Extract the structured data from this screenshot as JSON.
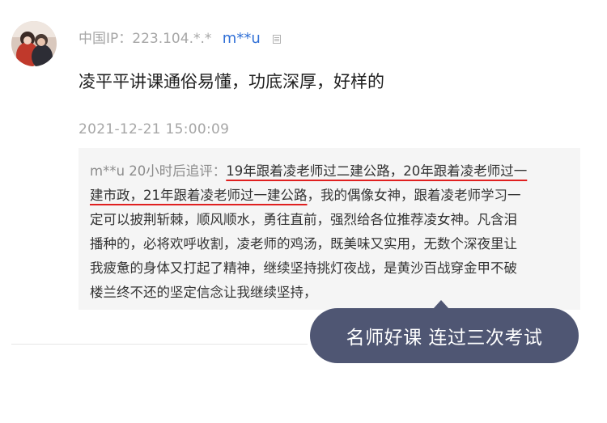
{
  "comment_card": {
    "ip_label": "中国IP：223.104.*.*",
    "username": "m**u",
    "comment_text": "凌平平讲课通俗易懂，功底深厚，好样的",
    "timestamp": "2021-12-21 15:00:09",
    "followup": {
      "prefix": "m**u 20小时后追评：",
      "lines": [
        {
          "hl": "19年跟着凌老师过二建公路，20年跟着凌老师过一",
          "rest": ""
        },
        {
          "hl": "建市政，21年跟着凌老师过一建公路",
          "rest": "，我的偶像女神，跟着凌老师学习一"
        },
        {
          "hl": "",
          "rest": "定可以披荆斩棘，顺风顺水，勇往直前，强烈给各位推荐凌女神。凡含泪"
        },
        {
          "hl": "",
          "rest": "播种的，必将欢呼收割，凌老师的鸡汤，既美味又实用，无数个深夜里让"
        },
        {
          "hl": "",
          "rest": "我疲惫的身体又打起了精神，继续坚持挑灯夜战，是黄沙百战穿金甲不破"
        },
        {
          "hl": "",
          "rest": "楼兰终不还的坚定信念让我继续坚持，"
        }
      ]
    }
  },
  "overlay_bubble": {
    "text": "名师好课 连过三次考试",
    "color": "#4f5673"
  },
  "icons": {
    "avatar": "user-avatar-photo",
    "badge": "document-badge-icon"
  }
}
